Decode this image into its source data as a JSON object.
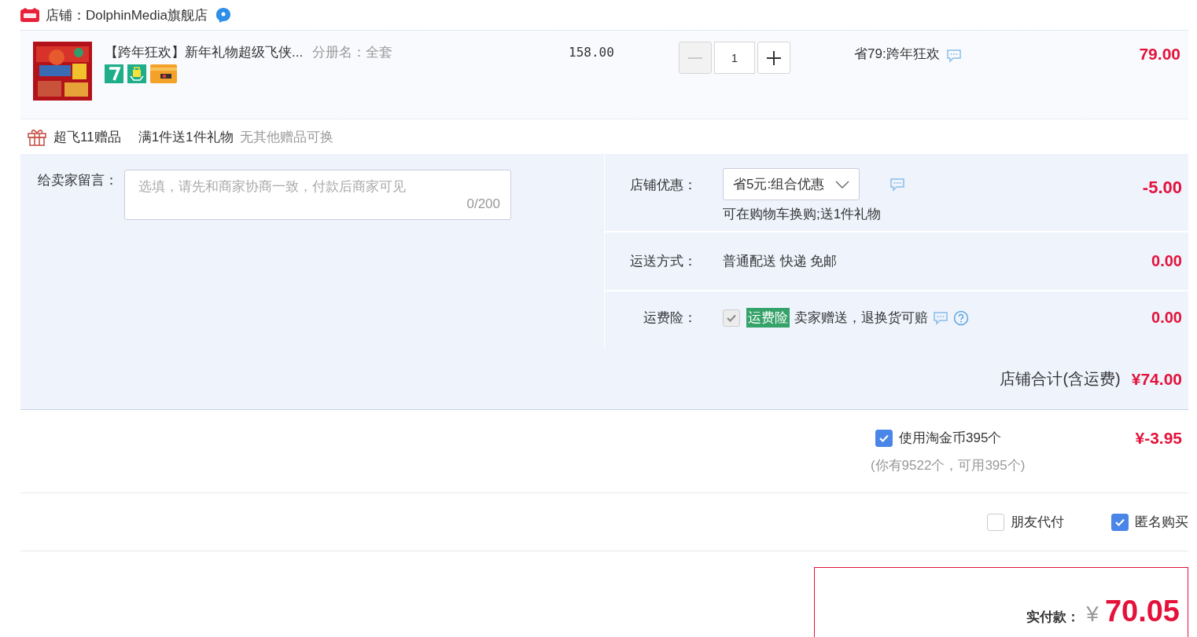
{
  "shop": {
    "label": "店铺：DolphinMedia旗舰店"
  },
  "item": {
    "title": "【跨年狂欢】新年礼物超级飞侠...",
    "variant": "分册名：全套",
    "price": "158.00",
    "quantity": "1",
    "minus_disabled": true,
    "promo": "省79:跨年狂欢",
    "subtotal": "79.00"
  },
  "gift": {
    "title": "超飞11赠品",
    "rule": "满1件送1件礼物",
    "note": "无其他赠品可换"
  },
  "message": {
    "label": "给卖家留言：",
    "placeholder": "选填，请先和商家协商一致，付款后商家可见",
    "counter": "0/200"
  },
  "fees": [
    {
      "kind": "select",
      "label": "店铺优惠：",
      "value": "省5元:组合优惠",
      "note": "可在购物车换购;送1件礼物",
      "amount": "-5.00"
    },
    {
      "kind": "text",
      "label": "运送方式：",
      "value": "普通配送 快递 免邮",
      "amount": "0.00"
    },
    {
      "kind": "insurance",
      "label": "运费险：",
      "checked": true,
      "badge": "运费险",
      "value": "卖家赠送，退换货可赔",
      "amount": "0.00"
    }
  ],
  "store_total": {
    "label": "店铺合计(含运费)",
    "amount": "¥74.00"
  },
  "coins": {
    "checked": true,
    "label": "使用淘金币395个",
    "detail": "(你有9522个，可用395个)",
    "amount": "¥-3.95"
  },
  "options": [
    {
      "label": "朋友代付",
      "checked": false
    },
    {
      "label": "匿名购买",
      "checked": true
    }
  ],
  "payment": {
    "label": "实付款：",
    "currency": "¥",
    "amount": "70.05"
  }
}
